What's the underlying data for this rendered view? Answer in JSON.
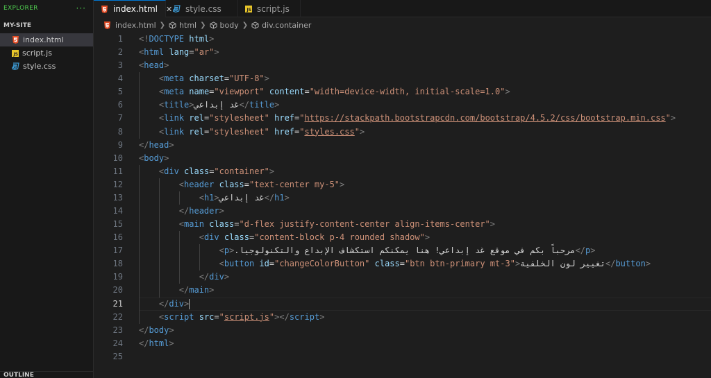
{
  "sidebar": {
    "title": "EXPLORER",
    "more": "···",
    "section": "MY-SITE",
    "files": [
      {
        "name": "index.html",
        "icon": "html-file-icon",
        "active": true
      },
      {
        "name": "script.js",
        "icon": "js-file-icon",
        "active": false
      },
      {
        "name": "style.css",
        "icon": "css-file-icon",
        "active": false
      }
    ],
    "outline": "OUTLINE"
  },
  "tabs": [
    {
      "label": "index.html",
      "icon": "html-file-icon",
      "active": true,
      "close": "✕"
    },
    {
      "label": "style.css",
      "icon": "css-file-icon",
      "active": false
    },
    {
      "label": "script.js",
      "icon": "js-file-icon",
      "active": false
    }
  ],
  "breadcrumb": [
    "index.html",
    "html",
    "body",
    "div.container"
  ],
  "editor": {
    "current_line": 21,
    "lines": [
      {
        "n": "1",
        "tokens": [
          [
            "t",
            "<!"
          ],
          [
            "g",
            "DOCTYPE"
          ],
          [
            "a",
            " html"
          ],
          [
            "t",
            ">"
          ]
        ]
      },
      {
        "n": "2",
        "tokens": [
          [
            "t",
            "<"
          ],
          [
            "g",
            "html"
          ],
          [
            "a",
            " lang"
          ],
          [
            "x",
            "="
          ],
          [
            "s",
            "\"ar\""
          ],
          [
            "t",
            ">"
          ]
        ]
      },
      {
        "n": "3",
        "tokens": [
          [
            "t",
            "<"
          ],
          [
            "g",
            "head"
          ],
          [
            "t",
            ">"
          ]
        ]
      },
      {
        "n": "4",
        "tokens": [
          [
            "x",
            "    "
          ],
          [
            "t",
            "<"
          ],
          [
            "g",
            "meta"
          ],
          [
            "a",
            " charset"
          ],
          [
            "x",
            "="
          ],
          [
            "s",
            "\"UTF-8\""
          ],
          [
            "t",
            ">"
          ]
        ]
      },
      {
        "n": "5",
        "tokens": [
          [
            "x",
            "    "
          ],
          [
            "t",
            "<"
          ],
          [
            "g",
            "meta"
          ],
          [
            "a",
            " name"
          ],
          [
            "x",
            "="
          ],
          [
            "s",
            "\"viewport\""
          ],
          [
            "a",
            " content"
          ],
          [
            "x",
            "="
          ],
          [
            "s",
            "\"width=device-width, initial-scale=1.0\""
          ],
          [
            "t",
            ">"
          ]
        ]
      },
      {
        "n": "6",
        "tokens": [
          [
            "x",
            "    "
          ],
          [
            "t",
            "<"
          ],
          [
            "g",
            "title"
          ],
          [
            "t",
            ">"
          ],
          [
            "x",
            "غد إبداعي"
          ],
          [
            "t",
            "</"
          ],
          [
            "g",
            "title"
          ],
          [
            "t",
            ">"
          ]
        ]
      },
      {
        "n": "7",
        "tokens": [
          [
            "x",
            "    "
          ],
          [
            "t",
            "<"
          ],
          [
            "g",
            "link"
          ],
          [
            "a",
            " rel"
          ],
          [
            "x",
            "="
          ],
          [
            "s",
            "\"stylesheet\""
          ],
          [
            "a",
            " href"
          ],
          [
            "x",
            "="
          ],
          [
            "s",
            "\""
          ],
          [
            "u",
            "https://stackpath.bootstrapcdn.com/bootstrap/4.5.2/css/bootstrap.min.css"
          ],
          [
            "s",
            "\""
          ],
          [
            "t",
            ">"
          ]
        ]
      },
      {
        "n": "8",
        "tokens": [
          [
            "x",
            "    "
          ],
          [
            "t",
            "<"
          ],
          [
            "g",
            "link"
          ],
          [
            "a",
            " rel"
          ],
          [
            "x",
            "="
          ],
          [
            "s",
            "\"stylesheet\""
          ],
          [
            "a",
            " href"
          ],
          [
            "x",
            "="
          ],
          [
            "s",
            "\""
          ],
          [
            "u",
            "styles.css"
          ],
          [
            "s",
            "\""
          ],
          [
            "t",
            ">"
          ]
        ]
      },
      {
        "n": "9",
        "tokens": [
          [
            "t",
            "</"
          ],
          [
            "g",
            "head"
          ],
          [
            "t",
            ">"
          ]
        ]
      },
      {
        "n": "10",
        "tokens": [
          [
            "t",
            "<"
          ],
          [
            "g",
            "body"
          ],
          [
            "t",
            ">"
          ]
        ]
      },
      {
        "n": "11",
        "tokens": [
          [
            "x",
            "    "
          ],
          [
            "t",
            "<"
          ],
          [
            "g",
            "div"
          ],
          [
            "a",
            " class"
          ],
          [
            "x",
            "="
          ],
          [
            "s",
            "\"container\""
          ],
          [
            "t",
            ">"
          ]
        ]
      },
      {
        "n": "12",
        "tokens": [
          [
            "x",
            "        "
          ],
          [
            "t",
            "<"
          ],
          [
            "g",
            "header"
          ],
          [
            "a",
            " class"
          ],
          [
            "x",
            "="
          ],
          [
            "s",
            "\"text-center my-5\""
          ],
          [
            "t",
            ">"
          ]
        ]
      },
      {
        "n": "13",
        "tokens": [
          [
            "x",
            "            "
          ],
          [
            "t",
            "<"
          ],
          [
            "g",
            "h1"
          ],
          [
            "t",
            ">"
          ],
          [
            "x",
            "غد إبداعي"
          ],
          [
            "t",
            "</"
          ],
          [
            "g",
            "h1"
          ],
          [
            "t",
            ">"
          ]
        ]
      },
      {
        "n": "14",
        "tokens": [
          [
            "x",
            "        "
          ],
          [
            "t",
            "</"
          ],
          [
            "g",
            "header"
          ],
          [
            "t",
            ">"
          ]
        ]
      },
      {
        "n": "15",
        "tokens": [
          [
            "x",
            "        "
          ],
          [
            "t",
            "<"
          ],
          [
            "g",
            "main"
          ],
          [
            "a",
            " class"
          ],
          [
            "x",
            "="
          ],
          [
            "s",
            "\"d-flex justify-content-center align-items-center\""
          ],
          [
            "t",
            ">"
          ]
        ]
      },
      {
        "n": "16",
        "tokens": [
          [
            "x",
            "            "
          ],
          [
            "t",
            "<"
          ],
          [
            "g",
            "div"
          ],
          [
            "a",
            " class"
          ],
          [
            "x",
            "="
          ],
          [
            "s",
            "\"content-block p-4 rounded shadow\""
          ],
          [
            "t",
            ">"
          ]
        ]
      },
      {
        "n": "17",
        "tokens": [
          [
            "x",
            "                "
          ],
          [
            "t",
            "<"
          ],
          [
            "g",
            "p"
          ],
          [
            "t",
            ">"
          ],
          [
            "x",
            "مرحباً بكم في موقع غد إبداعي! هنا يمكنكم استكشاف الإبداع والتكنولوجيا."
          ],
          [
            "t",
            "</"
          ],
          [
            "g",
            "p"
          ],
          [
            "t",
            ">"
          ]
        ]
      },
      {
        "n": "18",
        "tokens": [
          [
            "x",
            "                "
          ],
          [
            "t",
            "<"
          ],
          [
            "g",
            "button"
          ],
          [
            "a",
            " id"
          ],
          [
            "x",
            "="
          ],
          [
            "s",
            "\"changeColorButton\""
          ],
          [
            "a",
            " class"
          ],
          [
            "x",
            "="
          ],
          [
            "s",
            "\"btn btn-primary mt-3\""
          ],
          [
            "t",
            ">"
          ],
          [
            "x",
            "تغيير لون الخلفية"
          ],
          [
            "t",
            "</"
          ],
          [
            "g",
            "button"
          ],
          [
            "t",
            ">"
          ]
        ]
      },
      {
        "n": "19",
        "tokens": [
          [
            "x",
            "            "
          ],
          [
            "t",
            "</"
          ],
          [
            "g",
            "div"
          ],
          [
            "t",
            ">"
          ]
        ]
      },
      {
        "n": "20",
        "tokens": [
          [
            "x",
            "        "
          ],
          [
            "t",
            "</"
          ],
          [
            "g",
            "main"
          ],
          [
            "t",
            ">"
          ]
        ]
      },
      {
        "n": "21",
        "tokens": [
          [
            "x",
            "    "
          ],
          [
            "t",
            "</"
          ],
          [
            "g",
            "div"
          ],
          [
            "t",
            ">"
          ],
          [
            "c",
            ""
          ]
        ]
      },
      {
        "n": "22",
        "tokens": [
          [
            "x",
            "    "
          ],
          [
            "t",
            "<"
          ],
          [
            "g",
            "script"
          ],
          [
            "a",
            " src"
          ],
          [
            "x",
            "="
          ],
          [
            "s",
            "\""
          ],
          [
            "u",
            "script.js"
          ],
          [
            "s",
            "\""
          ],
          [
            "t",
            "></"
          ],
          [
            "g",
            "script"
          ],
          [
            "t",
            ">"
          ]
        ]
      },
      {
        "n": "23",
        "tokens": [
          [
            "t",
            "</"
          ],
          [
            "g",
            "body"
          ],
          [
            "t",
            ">"
          ]
        ]
      },
      {
        "n": "24",
        "tokens": [
          [
            "t",
            "</"
          ],
          [
            "g",
            "html"
          ],
          [
            "t",
            ">"
          ]
        ]
      },
      {
        "n": "25",
        "tokens": []
      }
    ]
  }
}
